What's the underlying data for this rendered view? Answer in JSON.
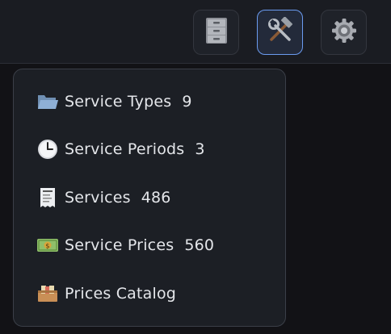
{
  "toolbar": {
    "buttons": [
      {
        "icon": "file-cabinet-icon",
        "active": false
      },
      {
        "icon": "hammer-wrench-icon",
        "active": true
      },
      {
        "icon": "gear-icon",
        "active": false
      }
    ]
  },
  "menu": {
    "items": [
      {
        "icon": "open-folder-icon",
        "label": "Service Types",
        "count": "9"
      },
      {
        "icon": "clock-icon",
        "label": "Service Periods",
        "count": "3"
      },
      {
        "icon": "receipt-icon",
        "label": "Services",
        "count": "486"
      },
      {
        "icon": "money-bill-icon",
        "label": "Service Prices",
        "count": "560"
      },
      {
        "icon": "card-box-icon",
        "label": "Prices Catalog",
        "count": ""
      }
    ]
  },
  "colors": {
    "background": "#121216",
    "toolbar": "#1a1c22",
    "panel": "#1c1f25",
    "active_border": "#6b9bf0",
    "text": "#e4e6ea"
  }
}
